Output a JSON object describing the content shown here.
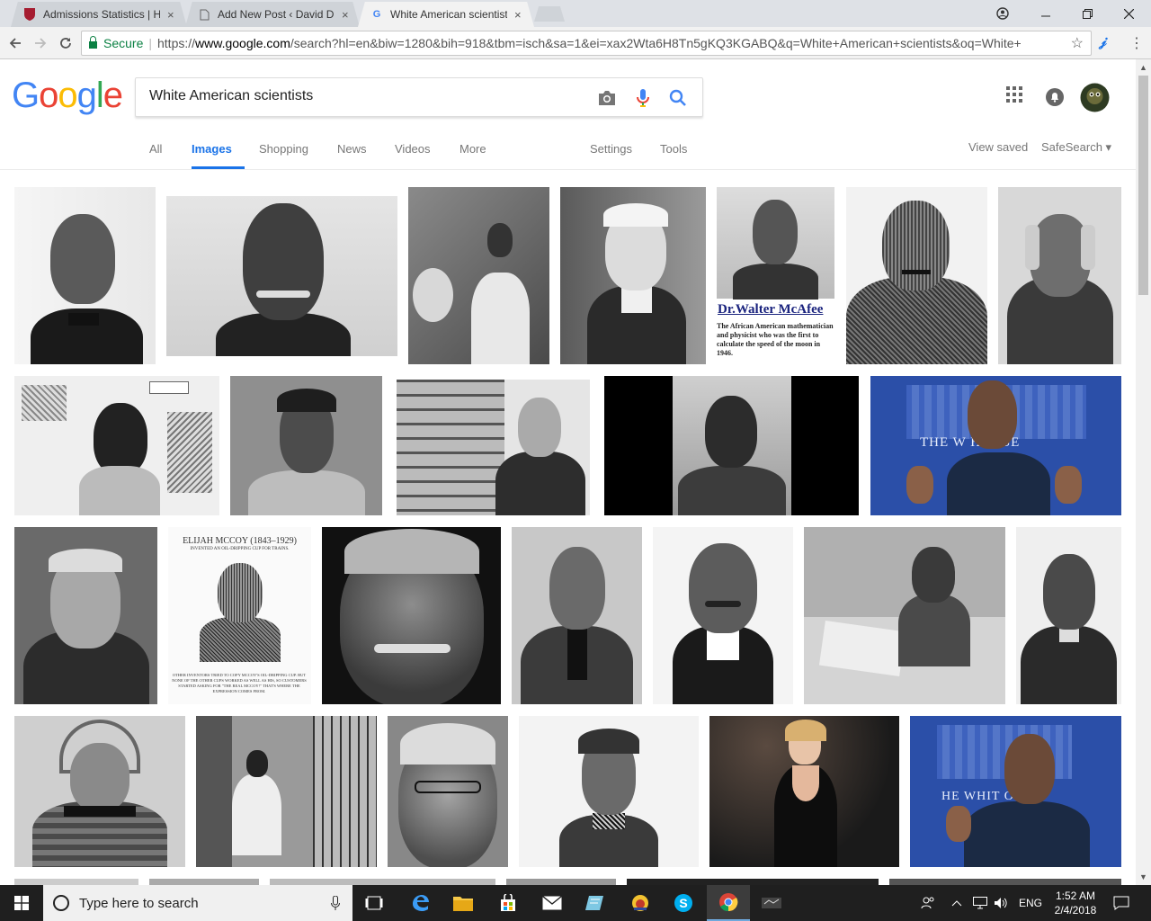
{
  "browser": {
    "tabs": [
      {
        "title": "Admissions Statistics | Ha",
        "favicon": "harvard-shield-icon",
        "active": false
      },
      {
        "title": "Add New Post ‹ David Du",
        "favicon": "page-icon",
        "active": false
      },
      {
        "title": "White American scientist",
        "favicon": "google-g-icon",
        "active": true
      }
    ],
    "close_glyph": "×",
    "secure_label": "Secure",
    "url_scheme": "https://",
    "url_host": "www.google.com",
    "url_path": "/search?hl=en&biw=1280&bih=918&tbm=isch&sa=1&ei=xax2Wta6H8Tn5gKQ3KGABQ&q=White+American+scientists&oq=White+A..."
  },
  "google": {
    "logo_letters": [
      "G",
      "o",
      "o",
      "g",
      "l",
      "e"
    ],
    "logo_colors": [
      "#4285F4",
      "#EA4335",
      "#FBBC05",
      "#4285F4",
      "#34A853",
      "#EA4335"
    ],
    "query": "White American scientists",
    "tabs": [
      "All",
      "Images",
      "Shopping",
      "News",
      "Videos",
      "More"
    ],
    "active_tab": "Images",
    "settings_label": "Settings",
    "tools_label": "Tools",
    "view_saved_label": "View saved",
    "safesearch_label": "SafeSearch ▾",
    "accent_color": "#1a73e8"
  },
  "results": {
    "mcafee_title": "Dr.Walter McAfee",
    "mcafee_desc": "The African American mathematician and physicist who was the first to calculate the speed of the moon in 1946.",
    "mccoy_title": "ELIJAH MCCOY (1843–1929)",
    "mccoy_subtitle": "INVENTED AN OIL-DRIPPING CUP FOR TRAINS.",
    "mccoy_footer": "OTHER INVENTORS TRIED TO COPY MCCOY'S OIL-DRIPPING CUP. BUT NONE OF THE OTHER CUPS WORKED AS WELL AS HIS, SO CUSTOMERS STARTED ASKING FOR \"THE REAL MCCOY!\" THAT'S WHERE THE EXPRESSION COMES FROM.",
    "wh_text_1": "THE W   HOUSE",
    "wh_text_2": "HE WHIT  OUSE"
  },
  "taskbar": {
    "search_placeholder": "Type here to search",
    "language": "ENG",
    "time": "1:52 AM",
    "date": "2/4/2018"
  }
}
